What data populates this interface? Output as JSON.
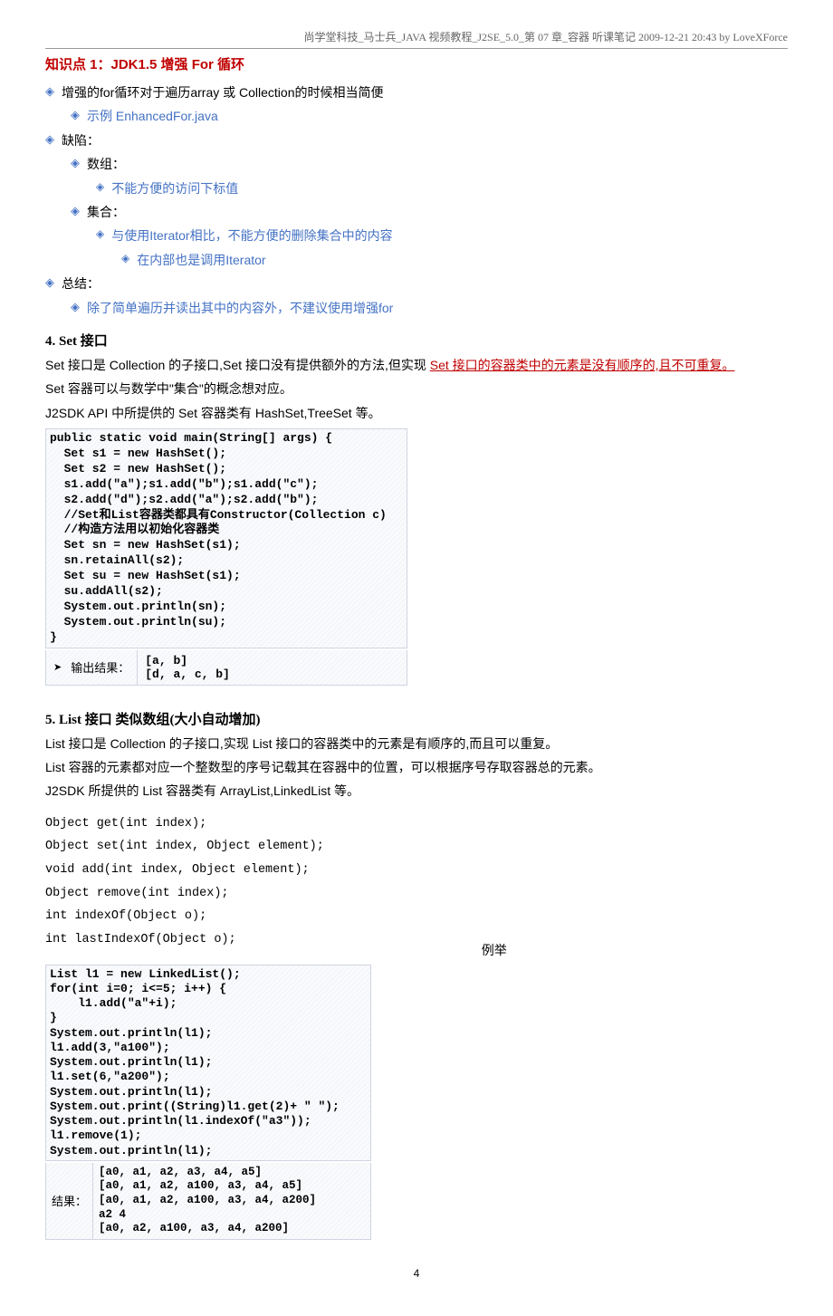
{
  "header": "尚学堂科技_马士兵_JAVA 视频教程_J2SE_5.0_第 07 章_容器  听课笔记  2009-12-21  20:43  by LoveXForce",
  "kp_title": "知识点 1：JDK1.5 增强 For 循环",
  "b1": "增强的for循环对于遍历array 或 Collection的时候相当简便",
  "b1a": "示例 EnhancedFor.java",
  "b2": "缺陷：",
  "b2a": "数组：",
  "b2a1": "不能方便的访问下标值",
  "b2b": "集合：",
  "b2b1": "与使用Iterator相比，不能方便的删除集合中的内容",
  "b2b1a": "在内部也是调用Iterator",
  "b3": "总结：",
  "b3a": "除了简单遍历并读出其中的内容外，不建议使用增强for",
  "sec4_title": "4.    Set 接口",
  "sec4_p1a": "Set 接口是 Collection 的子接口,Set 接口没有提供额外的方法,但实现 ",
  "sec4_p1b": "Set 接口的容器类中的元素是没有顺序的,且不可重复。",
  "sec4_p2": "Set 容器可以与数学中\"集合\"的概念想对应。",
  "sec4_p3": "J2SDK API 中所提供的 Set  容器类有 HashSet,TreeSet 等。",
  "code1": "public static void main(String[] args) {\n  Set s1 = new HashSet();\n  Set s2 = new HashSet();\n  s1.add(\"a\");s1.add(\"b\");s1.add(\"c\");\n  s2.add(\"d\");s2.add(\"a\");s2.add(\"b\");\n  //Set和List容器类都具有Constructor(Collection c)\n  //构造方法用以初始化容器类\n  Set sn = new HashSet(s1);\n  sn.retainAll(s2);\n  Set su = new HashSet(s1);\n  su.addAll(s2);\n  System.out.println(sn);\n  System.out.println(su);\n}",
  "out1_label": "输出结果：",
  "out1_val": "[a, b]\n[d, a, c, b]",
  "sec5_title": "5.    List 接口  类似数组(大小自动增加)",
  "sec5_p1": "List 接口是 Collection 的子接口,实现 List 接口的容器类中的元素是有顺序的,而且可以重复。",
  "sec5_p2": "List 容器的元素都对应一个整数型的序号记载其在容器中的位置，可以根据序号存取容器总的元素。",
  "sec5_p3": "J2SDK 所提供的 List 容器类有 ArrayList,LinkedList 等。",
  "methods": "Object get(int index);\nObject set(int index, Object element);\nvoid add(int index, Object element);\nObject remove(int index);\nint indexOf(Object o);\nint lastIndexOf(Object o);",
  "methods_label": "例举",
  "code2": "List l1 = new LinkedList();\nfor(int i=0; i<=5; i++) {\n    l1.add(\"a\"+i);\n}\nSystem.out.println(l1);\nl1.add(3,\"a100\");\nSystem.out.println(l1);\nl1.set(6,\"a200\");\nSystem.out.println(l1);\nSystem.out.print((String)l1.get(2)+ \" \");\nSystem.out.println(l1.indexOf(\"a3\"));\nl1.remove(1);\nSystem.out.println(l1);",
  "out2_label": "结果：",
  "out2_val": "[a0, a1, a2, a3, a4, a5]\n[a0, a1, a2, a100, a3, a4, a5]\n[a0, a1, a2, a100, a3, a4, a200]\na2 4\n[a0, a2, a100, a3, a4, a200]",
  "page_num": "4"
}
